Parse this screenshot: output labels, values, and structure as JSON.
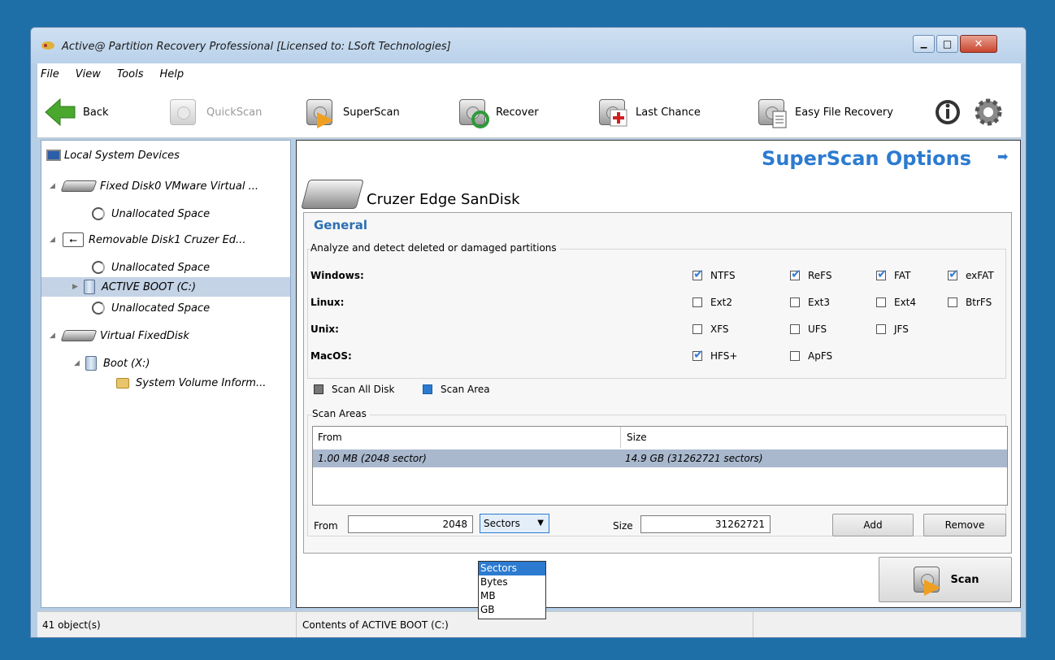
{
  "window": {
    "title": "Active@ Partition Recovery Professional [Licensed to: LSoft Technologies]",
    "controls": {
      "minimize": "▁",
      "maximize": "□",
      "close": "✕"
    }
  },
  "menu": [
    "File",
    "View",
    "Tools",
    "Help"
  ],
  "toolbar": {
    "back": "Back",
    "quickscan": "QuickScan",
    "superscan": "SuperScan",
    "recover": "Recover",
    "last_chance": "Last Chance",
    "easy_file_recovery": "Easy File Recovery"
  },
  "tree": {
    "root": "Local System Devices",
    "items": [
      {
        "label": "Fixed Disk0 VMware Virtual ..."
      },
      {
        "label": "Unallocated Space"
      },
      {
        "label": "Removable Disk1 Cruzer Ed..."
      },
      {
        "label": "Unallocated Space"
      },
      {
        "label": "ACTIVE BOOT (C:)"
      },
      {
        "label": "Unallocated Space"
      },
      {
        "label": "Virtual FixedDisk"
      },
      {
        "label": "Boot (X:)"
      },
      {
        "label": "System Volume Inform..."
      }
    ]
  },
  "options": {
    "title": "SuperScan Options",
    "device": "Cruzer Edge SanDisk",
    "section": "General",
    "group_label": "Analyze and detect deleted or damaged partitions",
    "os": [
      {
        "name": "Windows:",
        "fs": [
          {
            "label": "NTFS",
            "checked": true
          },
          {
            "label": "ReFS",
            "checked": true
          },
          {
            "label": "FAT",
            "checked": true
          },
          {
            "label": "exFAT",
            "checked": true
          }
        ]
      },
      {
        "name": "Linux:",
        "fs": [
          {
            "label": "Ext2",
            "checked": false
          },
          {
            "label": "Ext3",
            "checked": false
          },
          {
            "label": "Ext4",
            "checked": false
          },
          {
            "label": "BtrFS",
            "checked": false
          }
        ]
      },
      {
        "name": "Unix:",
        "fs": [
          {
            "label": "XFS",
            "checked": false
          },
          {
            "label": "UFS",
            "checked": false
          },
          {
            "label": "JFS",
            "checked": false
          }
        ]
      },
      {
        "name": "MacOS:",
        "fs": [
          {
            "label": "HFS+",
            "checked": true
          },
          {
            "label": "ApFS",
            "checked": false
          }
        ]
      }
    ],
    "scan_all_disk": "Scan All Disk",
    "scan_area": "Scan Area",
    "scan_areas_label": "Scan Areas",
    "table": {
      "headers": [
        "From",
        "Size"
      ],
      "rows": [
        [
          "1.00 MB (2048 sector)",
          "14.9 GB (31262721 sectors)"
        ]
      ]
    },
    "from_label": "From",
    "from_value": "2048",
    "unit_selected": "Sectors",
    "unit_options": [
      "Sectors",
      "Bytes",
      "MB",
      "GB"
    ],
    "size_label": "Size",
    "size_value": "31262721",
    "add": "Add",
    "remove": "Remove",
    "scan": "Scan"
  },
  "status": {
    "left": "41 object(s)",
    "middle": "Contents of ACTIVE BOOT (C:)"
  },
  "colors": {
    "accent": "#2c7bd0",
    "selection": "#a9b8cd",
    "desktop": "#1e6fa8"
  }
}
